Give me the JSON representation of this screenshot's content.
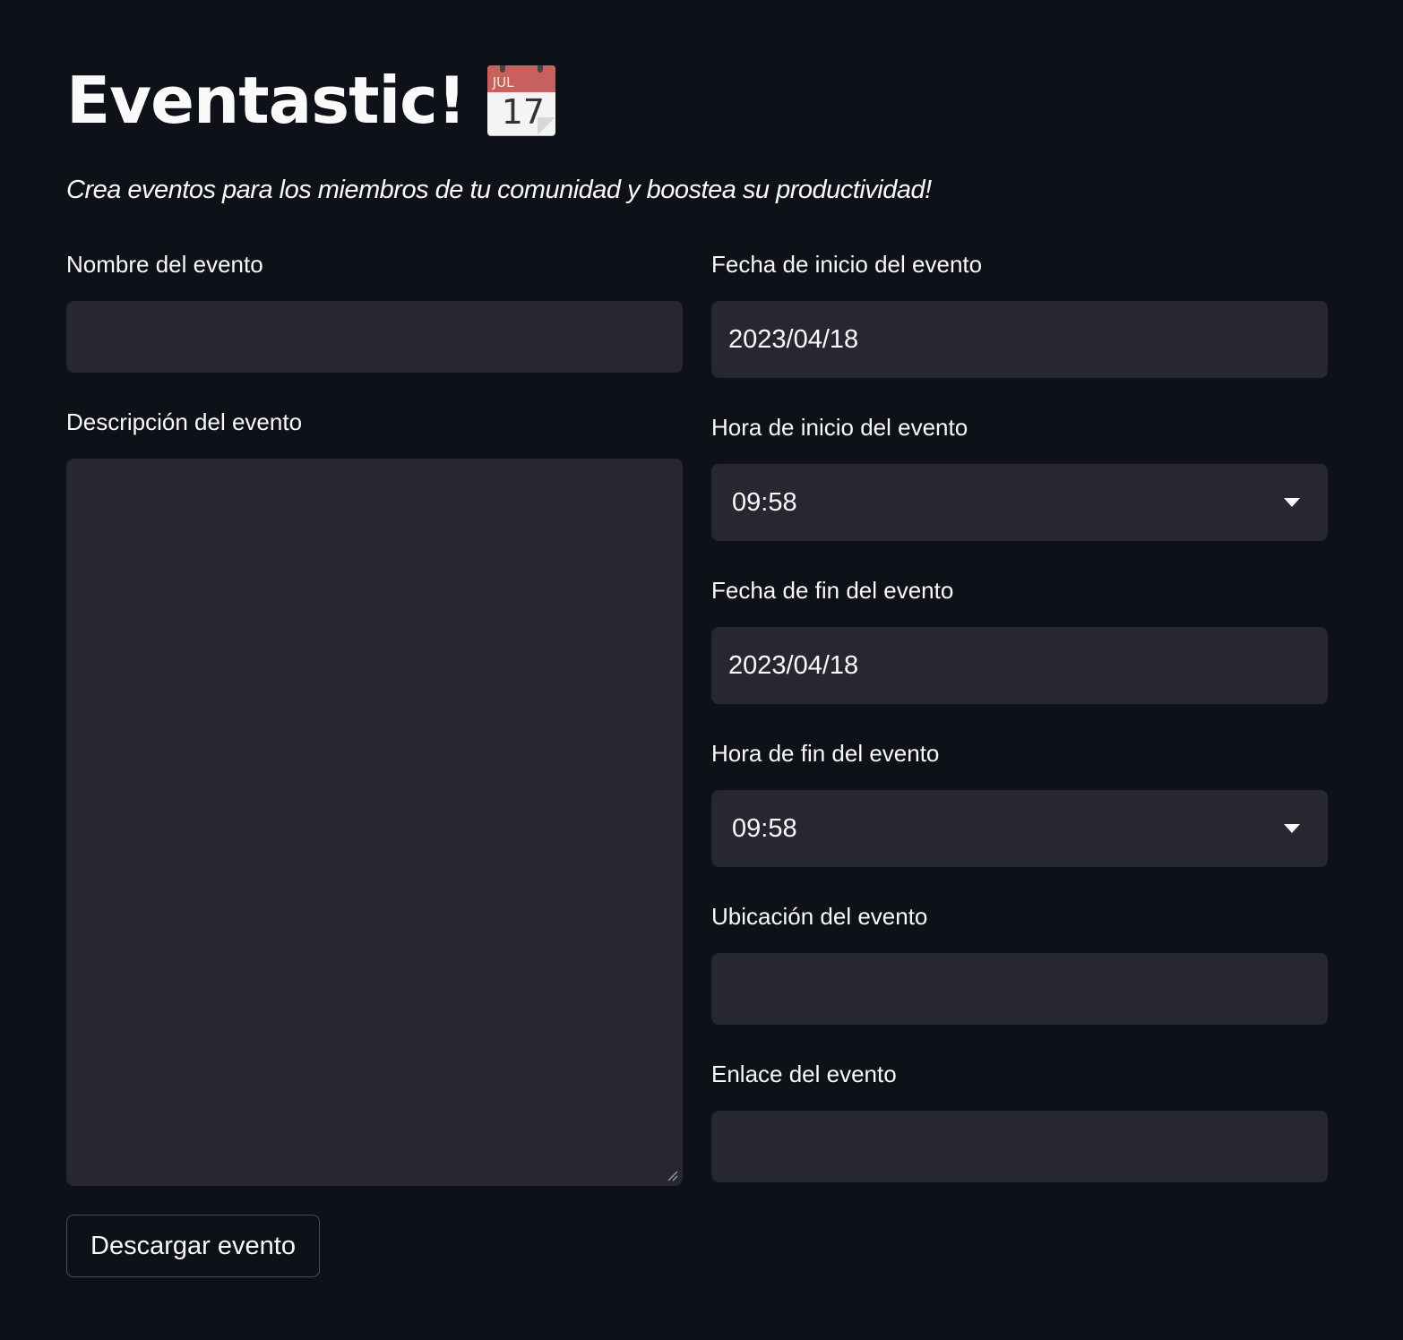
{
  "header": {
    "title": "Eventastic!",
    "title_icon": "calendar-icon",
    "calendar_month": "JUL",
    "calendar_day": "17",
    "subtitle": "Crea eventos para los miembros de tu comunidad y boostea su productividad!"
  },
  "form": {
    "name": {
      "label": "Nombre del evento",
      "value": ""
    },
    "description": {
      "label": "Descripción del evento",
      "value": ""
    },
    "start_date": {
      "label": "Fecha de inicio del evento",
      "value": "2023/04/18"
    },
    "start_time": {
      "label": "Hora de inicio del evento",
      "value": "09:58"
    },
    "end_date": {
      "label": "Fecha de fin del evento",
      "value": "2023/04/18"
    },
    "end_time": {
      "label": "Hora de fin del evento",
      "value": "09:58"
    },
    "location": {
      "label": "Ubicación del evento",
      "value": ""
    },
    "link": {
      "label": "Enlace del evento",
      "value": ""
    }
  },
  "actions": {
    "download_label": "Descargar evento"
  },
  "colors": {
    "background": "#0e1117",
    "input_background": "#262730",
    "text": "#fafafa",
    "button_border": "#4a4d57"
  }
}
